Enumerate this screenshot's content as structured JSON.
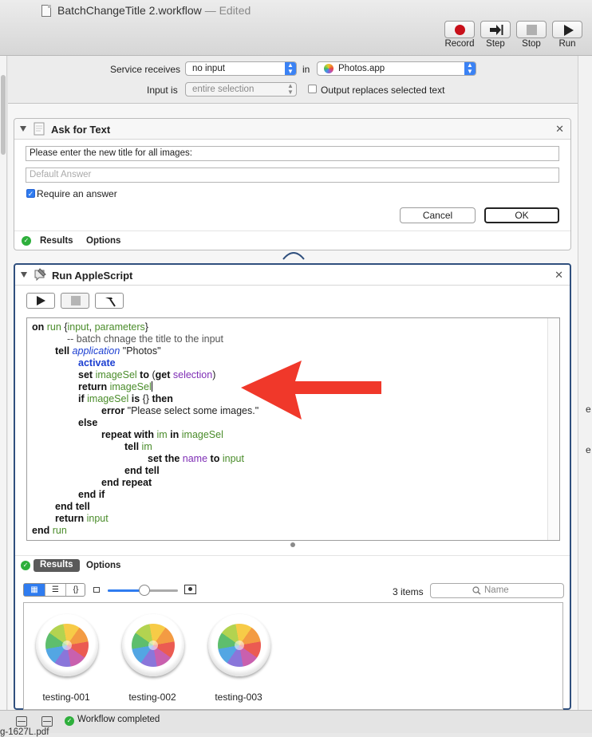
{
  "window": {
    "title": "BatchChangeTitle 2.workflow",
    "edited": "— Edited"
  },
  "toolbar": {
    "record": "Record",
    "step": "Step",
    "stop": "Stop",
    "run": "Run"
  },
  "service": {
    "receives_label": "Service receives",
    "receives_value": "no input",
    "in_label": "in",
    "app_value": "Photos.app",
    "input_is_label": "Input is",
    "input_is_value": "entire selection",
    "output_replaces_label": "Output replaces selected text",
    "output_replaces_checked": false
  },
  "ask_for_text": {
    "title": "Ask for Text",
    "question": "Please enter the new title for all images:",
    "default_answer_placeholder": "Default Answer",
    "require_answer_label": "Require an answer",
    "require_answer_checked": true,
    "cancel_label": "Cancel",
    "ok_label": "OK",
    "results_tab": "Results",
    "options_tab": "Options"
  },
  "run_applescript": {
    "title": "Run AppleScript",
    "results_tab": "Results",
    "options_tab": "Options",
    "code": {
      "l1": {
        "k1": "on",
        "v1": "run",
        "rest": " {",
        "v2": "input",
        "sep": ", ",
        "v3": "parameters",
        "end": "}"
      },
      "l2": {
        "comment": "-- batch chnage the title to the input"
      },
      "l3": {
        "k1": "tell",
        "app": "application",
        "str": " \"Photos\""
      },
      "l4": {
        "k1": "activate"
      },
      "l5": {
        "k1": "set",
        "v1": "imageSel",
        "k2": "to",
        "paren": "(",
        "k3": "get",
        "p1": "selection",
        "close": ")"
      },
      "l6": {
        "k1": "return",
        "v1": "imageSel"
      },
      "l7": {
        "k1": "if",
        "v1": "imageSel",
        "k2": "is",
        "braces": "{}",
        "k3": "then"
      },
      "l8": {
        "k1": "error",
        "str": " \"Please select some images.\""
      },
      "l9": {
        "k1": "else"
      },
      "l10": {
        "k1": "repeat with",
        "v1": "im",
        "k2": "in",
        "v2": "imageSel"
      },
      "l11": {
        "k1": "tell",
        "v1": "im"
      },
      "l12": {
        "k1": "set the",
        "p1": "name",
        "k2": "to",
        "v1": "input"
      },
      "l13": {
        "k1": "end tell"
      },
      "l14": {
        "k1": "end repeat"
      },
      "l15": {
        "k1": "end if"
      },
      "l16": {
        "k1": "end tell"
      },
      "l17": {
        "k1": "return",
        "v1": "input"
      },
      "l18": {
        "k1": "end",
        "v1": "run"
      }
    },
    "results": {
      "item_count": "3 items",
      "search_placeholder": "Name",
      "slider_fraction": 0.52,
      "items": [
        "testing-001",
        "testing-002",
        "testing-003"
      ]
    }
  },
  "status": {
    "text": "Workflow completed"
  },
  "fragments": {
    "right_edge": "e",
    "bottom_left": "g-1627L.pdf"
  },
  "colors": {
    "accent": "#2f7cf0",
    "ok_green": "#2eaf3c",
    "record_red": "#c8101a",
    "annotation_red": "#f0382a"
  },
  "icons": {
    "record": "record-dot-icon",
    "step": "step-icon",
    "stop": "stop-square-icon",
    "run": "play-icon",
    "ask_for_text": "text-doc-icon",
    "run_applescript": "script-icon",
    "photos": "photos-app-icon"
  }
}
